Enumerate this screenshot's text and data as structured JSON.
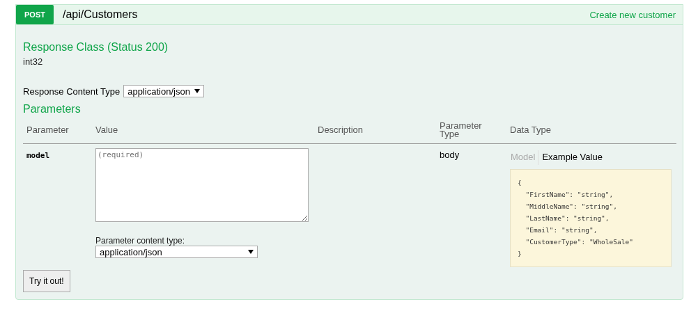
{
  "operation": {
    "method": "POST",
    "path": "/api/Customers",
    "summary": "Create new customer"
  },
  "response_class": {
    "heading": "Response Class (Status 200)",
    "type": "int32"
  },
  "response_content_type": {
    "label": "Response Content Type",
    "value": "application/json"
  },
  "parameters": {
    "heading": "Parameters",
    "columns": [
      "Parameter",
      "Value",
      "Description",
      "Parameter Type",
      "Data Type"
    ],
    "rows": [
      {
        "name": "model",
        "placeholder": "(required)",
        "content_type_label": "Parameter content type:",
        "content_type": "application/json",
        "param_type": "body",
        "tabs": [
          {
            "label": "Model",
            "selected": false
          },
          {
            "label": "Example Value",
            "selected": true
          }
        ],
        "example": [
          "{",
          "  \"FirstName\": \"string\",",
          "  \"MiddleName\": \"string\",",
          "  \"LastName\": \"string\",",
          "  \"Email\": \"string\",",
          "  \"CustomerType\": \"WholeSale\"",
          "}"
        ]
      }
    ]
  },
  "submit_button": "Try it out!"
}
